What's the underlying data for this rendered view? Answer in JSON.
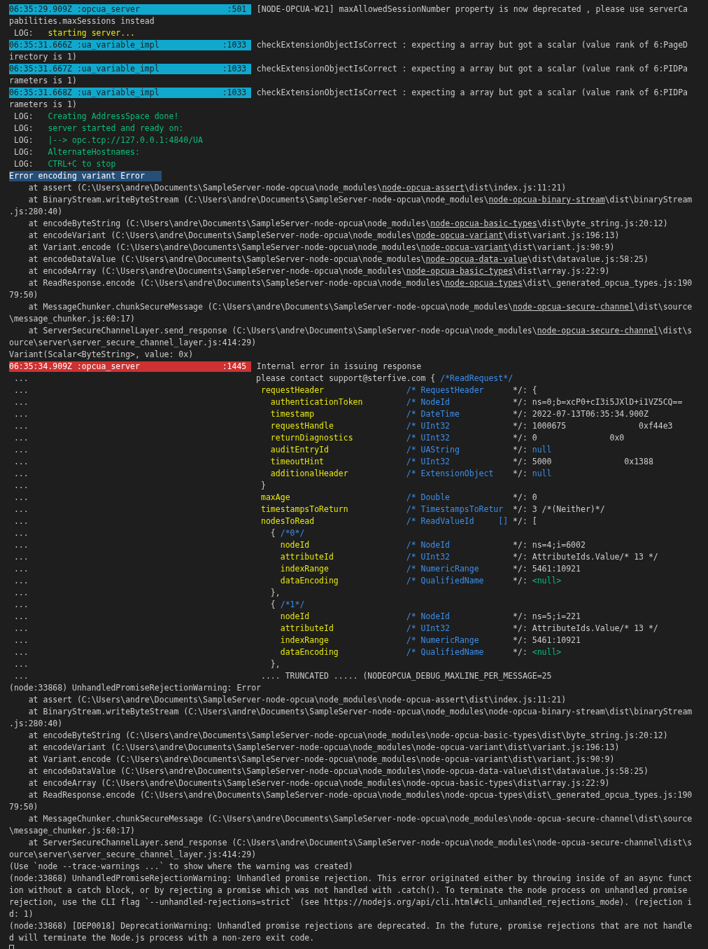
{
  "lines": [
    {
      "kind": "info",
      "source": "06:35:29.909Z :opcua_server",
      "line_number": ":501",
      "text": "[NODE-OPCUA-W21] maxAllowedSessionNumber property is now deprecated , please use serverCa"
    },
    {
      "kind": "plain",
      "text": "pabilities.maxSessions instead"
    },
    {
      "kind": "log",
      "label": "LOG:",
      "color": "#e5e510",
      "text": "starting server..."
    },
    {
      "kind": "info",
      "source": "06:35:31.666Z :ua_variable_impl",
      "line_number": ":1033",
      "text": "checkExtensionObjectIsCorrect : expecting a array but got a scalar (value rank of 6:PageD"
    },
    {
      "kind": "plain",
      "text": "irectory is 1)"
    },
    {
      "kind": "info",
      "source": "06:35:31.667Z :ua_variable_impl",
      "line_number": ":1033",
      "text": "checkExtensionObjectIsCorrect : expecting a array but got a scalar (value rank of 6:PIDPa"
    },
    {
      "kind": "plain",
      "text": "rameters is 1)"
    },
    {
      "kind": "info",
      "source": "06:35:31.668Z :ua_variable_impl",
      "line_number": ":1033",
      "text": "checkExtensionObjectIsCorrect : expecting a array but got a scalar (value rank of 6:PIDPa"
    },
    {
      "kind": "plain",
      "text": "rameters is 1)"
    },
    {
      "kind": "log",
      "label": "LOG:",
      "color": "#0dbc79",
      "text": "Creating AddressSpace done!"
    },
    {
      "kind": "log",
      "label": "LOG:",
      "color": "#0dbc79",
      "text": "server started and ready on:"
    },
    {
      "kind": "log",
      "label": "LOG:",
      "color": "#0dbc79",
      "text": "|--> opc.tcp://127.0.0.1:4840/UA"
    },
    {
      "kind": "log",
      "label": "LOG:",
      "color": "#0dbc79",
      "text": "AlternateHostnames:"
    },
    {
      "kind": "log",
      "label": "LOG:",
      "color": "#0dbc79",
      "text": "CTRL+C to stop"
    },
    {
      "kind": "highlight",
      "text": "Error encoding variant Error"
    },
    {
      "kind": "trace",
      "text": "    at assert (C:\\Users\\andre\\Documents\\SampleServer-node-opcua\\node_modules\\",
      "link": "node-opcua-assert",
      "rest": "\\dist\\index.js:11:21)"
    },
    {
      "kind": "trace",
      "text": "    at BinaryStream.writeByteStream (C:\\Users\\andre\\Documents\\SampleServer-node-opcua\\node_modules\\",
      "link": "node-opcua-binary-stream",
      "rest": "\\dist\\binaryStream"
    },
    {
      "kind": "plain",
      "text": ".js:280:40)"
    },
    {
      "kind": "trace",
      "text": "    at encodeByteString (C:\\Users\\andre\\Documents\\SampleServer-node-opcua\\node_modules\\",
      "link": "node-opcua-basic-types",
      "rest": "\\dist\\byte_string.js:20:12)"
    },
    {
      "kind": "trace",
      "text": "    at encodeVariant (C:\\Users\\andre\\Documents\\SampleServer-node-opcua\\node_modules\\",
      "link": "node-opcua-variant",
      "rest": "\\dist\\variant.js:196:13)"
    },
    {
      "kind": "trace",
      "text": "    at Variant.encode (C:\\Users\\andre\\Documents\\SampleServer-node-opcua\\node_modules\\",
      "link": "node-opcua-variant",
      "rest": "\\dist\\variant.js:90:9)"
    },
    {
      "kind": "trace",
      "text": "    at encodeDataValue (C:\\Users\\andre\\Documents\\SampleServer-node-opcua\\node_modules\\",
      "link": "node-opcua-data-value",
      "rest": "\\dist\\datavalue.js:58:25)"
    },
    {
      "kind": "trace",
      "text": "    at encodeArray (C:\\Users\\andre\\Documents\\SampleServer-node-opcua\\node_modules\\",
      "link": "node-opcua-basic-types",
      "rest": "\\dist\\array.js:22:9)"
    },
    {
      "kind": "trace",
      "text": "    at ReadResponse.encode (C:\\Users\\andre\\Documents\\SampleServer-node-opcua\\node_modules\\",
      "link": "node-opcua-types",
      "rest": "\\dist\\_generated_opcua_types.js:190"
    },
    {
      "kind": "plain",
      "text": "79:50)"
    },
    {
      "kind": "trace",
      "text": "    at MessageChunker.chunkSecureMessage (C:\\Users\\andre\\Documents\\SampleServer-node-opcua\\node_modules\\",
      "link": "node-opcua-secure-channel",
      "rest": "\\dist\\source"
    },
    {
      "kind": "plain",
      "text": "\\message_chunker.js:60:17)"
    },
    {
      "kind": "trace",
      "text": "    at ServerSecureChannelLayer.send_response (C:\\Users\\andre\\Documents\\SampleServer-node-opcua\\node_modules\\",
      "link": "node-opcua-secure-channel",
      "rest": "\\dist\\s"
    },
    {
      "kind": "plain",
      "text": "ource\\server\\server_secure_channel_layer.js:414:29)"
    },
    {
      "kind": "plain",
      "text": "Variant(Scalar<ByteString>, value: 0x)"
    },
    {
      "kind": "error",
      "source": "06:35:34.909Z :opcua_server",
      "line_number": ":1445",
      "text": "Internal error in issuing response"
    },
    {
      "kind": "brace",
      "dots": "...",
      "text": "please contact support@sterfive.com {",
      "comment": "/*ReadRequest*/"
    },
    {
      "kind": "field",
      "dots": "...",
      "name": " requestHeader",
      "type": "/* RequestHeader",
      "close": "*/:",
      "value": "{"
    },
    {
      "kind": "field",
      "dots": "...",
      "name": "   authenticationToken",
      "type": "/* NodeId",
      "close": "*/:",
      "value": "ns=0;b=xcP0+cI3i5JXlD+i1VZ5CQ=="
    },
    {
      "kind": "field",
      "dots": "...",
      "name": "   timestamp",
      "type": "/* DateTime",
      "close": "*/:",
      "value": "2022-07-13T06:35:34.900Z"
    },
    {
      "kind": "field",
      "dots": "...",
      "name": "   requestHandle",
      "type": "/* UInt32",
      "close": "*/:",
      "value": "1000675               0xf44e3"
    },
    {
      "kind": "field",
      "dots": "...",
      "name": "   returnDiagnostics",
      "type": "/* UInt32",
      "close": "*/:",
      "value": "0               0x0"
    },
    {
      "kind": "field",
      "dots": "...",
      "name": "   auditEntryId",
      "type": "/* UAString",
      "close": "*/:",
      "value": "null",
      "color": "#3b8eea"
    },
    {
      "kind": "field",
      "dots": "...",
      "name": "   timeoutHint",
      "type": "/* UInt32",
      "close": "*/:",
      "value": "5000               0x1388"
    },
    {
      "kind": "field",
      "dots": "...",
      "name": "   additionalHeader",
      "type": "/* ExtensionObject",
      "close": "*/:",
      "value": "null",
      "color": "#3b8eea"
    },
    {
      "kind": "brace",
      "dots": "...",
      "text": " }"
    },
    {
      "kind": "field",
      "dots": "...",
      "name": " maxAge",
      "type": "/* Double",
      "close": "*/:",
      "value": "0"
    },
    {
      "kind": "field",
      "dots": "...",
      "name": " timestampsToReturn",
      "type": "/* TimestampsToRetur",
      "close": "*/:",
      "value": "3 /*(Neither)*/"
    },
    {
      "kind": "field",
      "dots": "...",
      "name": " nodesToRead",
      "type": "/* ReadValueId     []",
      "close": "*/:",
      "value": "["
    },
    {
      "kind": "brace",
      "dots": "...",
      "text": "   {",
      "comment": "/*0*/"
    },
    {
      "kind": "field",
      "dots": "...",
      "name": "     nodeId",
      "type": "/* NodeId",
      "close": "*/:",
      "value": "ns=4;i=6002"
    },
    {
      "kind": "field",
      "dots": "...",
      "name": "     attributeId",
      "type": "/* UInt32",
      "close": "*/:",
      "value": "AttributeIds.Value/* 13 */"
    },
    {
      "kind": "field",
      "dots": "...",
      "name": "     indexRange",
      "type": "/* NumericRange",
      "close": "*/:",
      "value": "5461:10921"
    },
    {
      "kind": "field",
      "dots": "...",
      "name": "     dataEncoding",
      "type": "/* QualifiedName",
      "close": "*/:",
      "value": "<null>",
      "color": "#0dbc79"
    },
    {
      "kind": "brace",
      "dots": "...",
      "text": "   },"
    },
    {
      "kind": "brace",
      "dots": "...",
      "text": "   {",
      "comment": "/*1*/"
    },
    {
      "kind": "field",
      "dots": "...",
      "name": "     nodeId",
      "type": "/* NodeId",
      "close": "*/:",
      "value": "ns=5;i=221"
    },
    {
      "kind": "field",
      "dots": "...",
      "name": "     attributeId",
      "type": "/* UInt32",
      "close": "*/:",
      "value": "AttributeIds.Value/* 13 */"
    },
    {
      "kind": "field",
      "dots": "...",
      "name": "     indexRange",
      "type": "/* NumericRange",
      "close": "*/:",
      "value": "5461:10921"
    },
    {
      "kind": "field",
      "dots": "...",
      "name": "     dataEncoding",
      "type": "/* QualifiedName",
      "close": "*/:",
      "value": "<null>",
      "color": "#0dbc79"
    },
    {
      "kind": "brace",
      "dots": "...",
      "text": "   },"
    },
    {
      "kind": "brace",
      "dots": "...",
      "text": " .... TRUNCATED ..... (NODEOPCUA_DEBUG_MAXLINE_PER_MESSAGE=25"
    },
    {
      "kind": "plain",
      "text": "(node:33868) UnhandledPromiseRejectionWarning: Error"
    },
    {
      "kind": "plain",
      "text": "    at assert (C:\\Users\\andre\\Documents\\SampleServer-node-opcua\\node_modules\\node-opcua-assert\\dist\\index.js:11:21)"
    },
    {
      "kind": "plain",
      "text": "    at BinaryStream.writeByteStream (C:\\Users\\andre\\Documents\\SampleServer-node-opcua\\node_modules\\node-opcua-binary-stream\\dist\\binaryStream"
    },
    {
      "kind": "plain",
      "text": ".js:280:40)"
    },
    {
      "kind": "plain",
      "text": "    at encodeByteString (C:\\Users\\andre\\Documents\\SampleServer-node-opcua\\node_modules\\node-opcua-basic-types\\dist\\byte_string.js:20:12)"
    },
    {
      "kind": "plain",
      "text": "    at encodeVariant (C:\\Users\\andre\\Documents\\SampleServer-node-opcua\\node_modules\\node-opcua-variant\\dist\\variant.js:196:13)"
    },
    {
      "kind": "plain",
      "text": "    at Variant.encode (C:\\Users\\andre\\Documents\\SampleServer-node-opcua\\node_modules\\node-opcua-variant\\dist\\variant.js:90:9)"
    },
    {
      "kind": "plain",
      "text": "    at encodeDataValue (C:\\Users\\andre\\Documents\\SampleServer-node-opcua\\node_modules\\node-opcua-data-value\\dist\\datavalue.js:58:25)"
    },
    {
      "kind": "plain",
      "text": "    at encodeArray (C:\\Users\\andre\\Documents\\SampleServer-node-opcua\\node_modules\\node-opcua-basic-types\\dist\\array.js:22:9)"
    },
    {
      "kind": "plain",
      "text": "    at ReadResponse.encode (C:\\Users\\andre\\Documents\\SampleServer-node-opcua\\node_modules\\node-opcua-types\\dist\\_generated_opcua_types.js:190"
    },
    {
      "kind": "plain",
      "text": "79:50)"
    },
    {
      "kind": "plain",
      "text": "    at MessageChunker.chunkSecureMessage (C:\\Users\\andre\\Documents\\SampleServer-node-opcua\\node_modules\\node-opcua-secure-channel\\dist\\source"
    },
    {
      "kind": "plain",
      "text": "\\message_chunker.js:60:17)"
    },
    {
      "kind": "plain",
      "text": "    at ServerSecureChannelLayer.send_response (C:\\Users\\andre\\Documents\\SampleServer-node-opcua\\node_modules\\node-opcua-secure-channel\\dist\\s"
    },
    {
      "kind": "plain",
      "text": "ource\\server\\server_secure_channel_layer.js:414:29)"
    },
    {
      "kind": "plain",
      "text": "(Use `node --trace-warnings ...` to show where the warning was created)"
    },
    {
      "kind": "plain",
      "text": "(node:33868) UnhandledPromiseRejectionWarning: Unhandled promise rejection. This error originated either by throwing inside of an async funct"
    },
    {
      "kind": "plain",
      "text": "ion without a catch block, or by rejecting a promise which was not handled with .catch(). To terminate the node process on unhandled promise"
    },
    {
      "kind": "plain",
      "text": "rejection, use the CLI flag `--unhandled-rejections=strict` (see https://nodejs.org/api/cli.html#cli_unhandled_rejections_mode). (rejection i"
    },
    {
      "kind": "plain",
      "text": "d: 1)"
    },
    {
      "kind": "plain",
      "text": "(node:33868) [DEP0018] DeprecationWarning: Unhandled promise rejections are deprecated. In the future, promise rejections that are not handle"
    },
    {
      "kind": "plain",
      "text": "d will terminate the Node.js process with a non-zero exit code."
    }
  ]
}
